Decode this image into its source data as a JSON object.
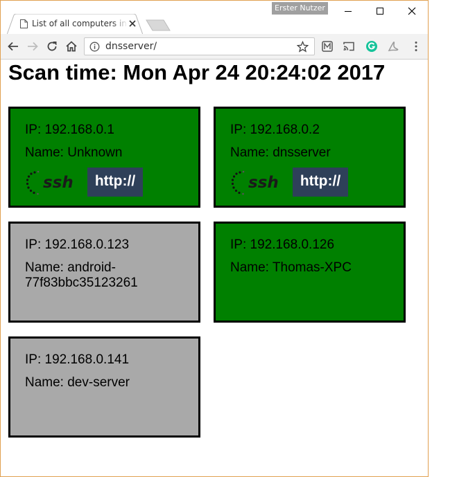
{
  "browser": {
    "user_badge": "Erster Nutzer",
    "tab_title": "List of all computers in th",
    "address": "dnsserver/"
  },
  "page": {
    "scan_time": "Scan time: Mon Apr 24 20:24:02 2017"
  },
  "computers": [
    {
      "ip": "IP: 192.168.0.1",
      "name": "Name: Unknown",
      "status": "online",
      "ssh_label": "ssh",
      "http_label": "http://"
    },
    {
      "ip": "IP: 192.168.0.2",
      "name": "Name: dnsserver",
      "status": "online",
      "ssh_label": "ssh",
      "http_label": "http://"
    },
    {
      "ip": "IP: 192.168.0.123",
      "name": "Name: android-77f83bbc35123261",
      "status": "offline"
    },
    {
      "ip": "IP: 192.168.0.126",
      "name": "Name: Thomas-XPC",
      "status": "online"
    },
    {
      "ip": "IP: 192.168.0.141",
      "name": "Name: dev-server",
      "status": "offline"
    }
  ],
  "colors": {
    "online": "#008000",
    "offline": "#a9a9a9",
    "http_button": "#2e4059"
  },
  "icons": [
    "page-icon",
    "close-icon",
    "back-arrow-icon",
    "forward-arrow-icon",
    "reload-icon",
    "home-icon",
    "info-icon",
    "star-icon",
    "extension-icon",
    "cast-icon",
    "grammarly-icon",
    "pdf-icon",
    "menu-icon",
    "minimize-icon",
    "maximize-icon"
  ]
}
